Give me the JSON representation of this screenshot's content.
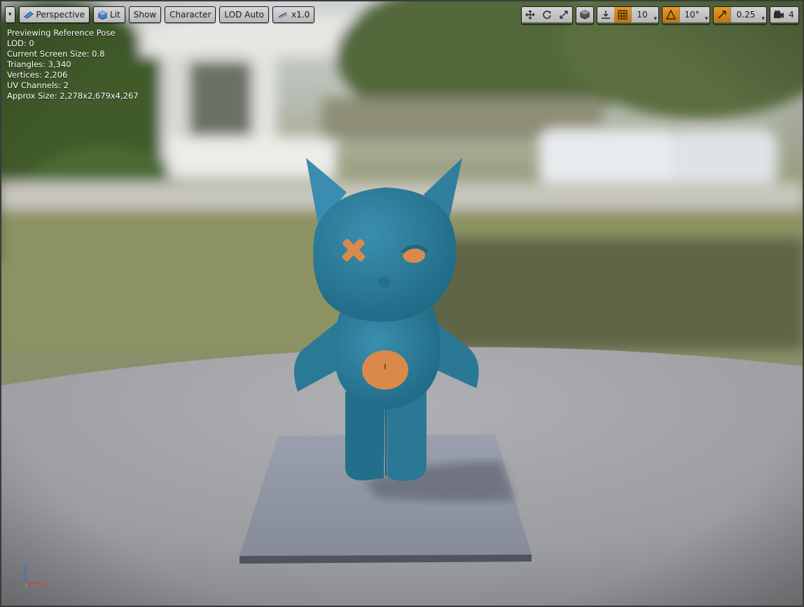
{
  "toolbar": {
    "menu_caret": "▾",
    "view_mode": "Perspective",
    "lighting": "Lit",
    "show": "Show",
    "character": "Character",
    "lod": "LOD Auto",
    "speed": "x1.0",
    "grid_snap_value": "10",
    "rotation_snap_value": "10°",
    "scale_snap_value": "0.25",
    "camera_speed_value": "4"
  },
  "stats": [
    "Previewing Reference Pose",
    "LOD: 0",
    "Current Screen Size: 0.8",
    "Triangles: 3,340",
    "Vertices: 2,206",
    "UV Channels: 2",
    "Approx Size: 2,278x2,679x4,267"
  ],
  "axis": {
    "z": "Z",
    "x": "X"
  },
  "colors": {
    "accent": "#d98c1f",
    "character_body": "#2e7d9a",
    "patch": "#d98a4a",
    "platform": "#8c93a3"
  }
}
